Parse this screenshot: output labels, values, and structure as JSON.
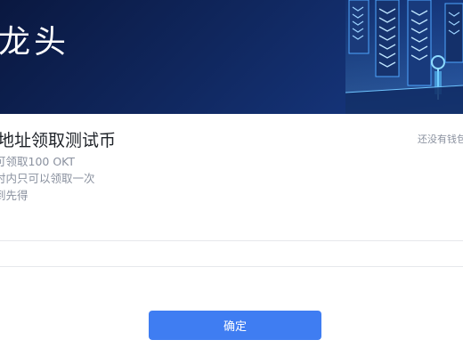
{
  "hero": {
    "title": "龙头"
  },
  "faucet": {
    "title": "地址领取测试币",
    "rules": [
      "可领取100 OKT",
      "时内只可以领取一次",
      "到先得"
    ],
    "wallet_link": "还没有钱包"
  },
  "actions": {
    "confirm_label": "确定"
  },
  "colors": {
    "hero_background": "#10275e",
    "primary_button": "#3f7df2",
    "secondary_text": "#8a919f"
  },
  "icons": [
    "server-illustration"
  ]
}
